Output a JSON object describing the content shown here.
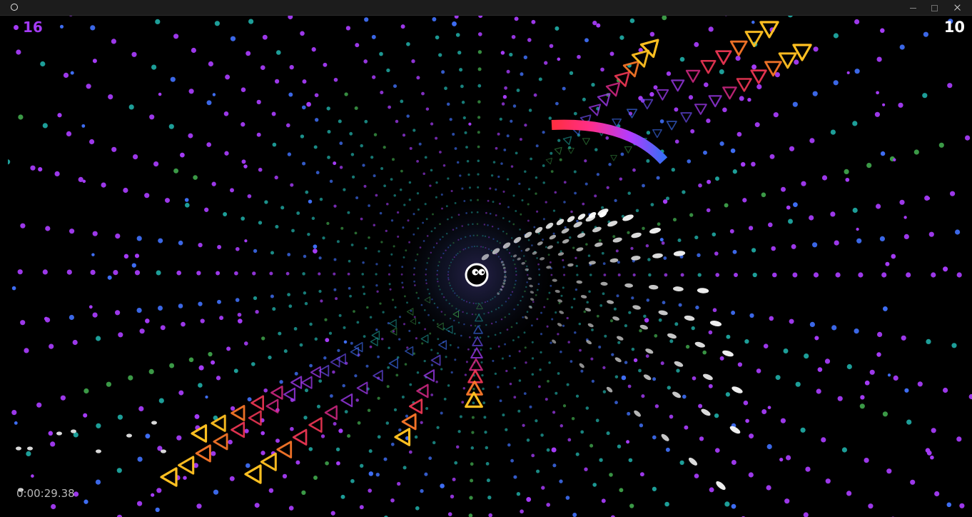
{
  "window": {
    "controls": {
      "minimize": "–",
      "maximize": "□",
      "close": "✕"
    },
    "icon": "circle-icon"
  },
  "hud": {
    "gems": "16",
    "score": "10",
    "timer": "0:00:29.38",
    "gem_color": "#a43bf5"
  },
  "player": {
    "icon": "eyes-ball-icon",
    "color": "#ffffff"
  },
  "colors": {
    "purple": "#a43bf5",
    "blue": "#3e6df2",
    "teal": "#1fa6a0",
    "green": "#3ea14a",
    "red": "#ff2e3e",
    "pink": "#e02a8c",
    "orange": "#ff7a2a",
    "yellow": "#ffc021",
    "white": "#ffffff"
  },
  "hazards": {
    "triangle_trails": 6,
    "bullet_trails": 10,
    "laser_arc": 1
  }
}
